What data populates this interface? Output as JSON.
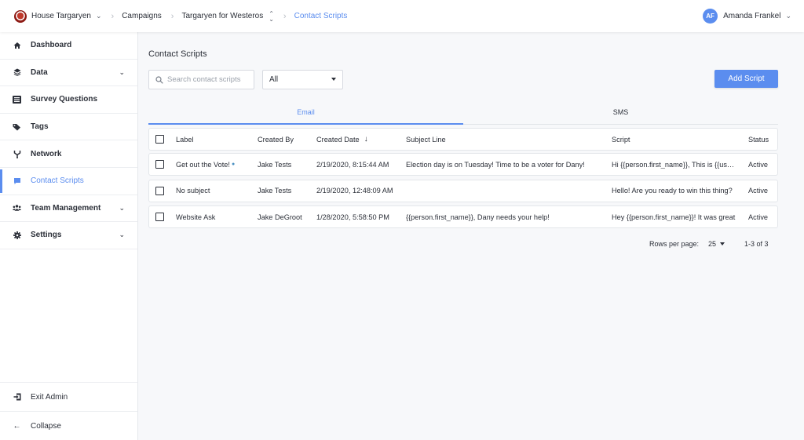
{
  "breadcrumbs": {
    "org": "House Targaryen",
    "campaigns": "Campaigns",
    "campaign": "Targaryen for Westeros",
    "current": "Contact Scripts"
  },
  "user": {
    "initials": "AF",
    "name": "Amanda Frankel"
  },
  "sidebar": {
    "items": [
      {
        "label": "Dashboard",
        "icon": "home-icon"
      },
      {
        "label": "Data",
        "icon": "layers-icon",
        "expandable": true
      },
      {
        "label": "Survey Questions",
        "icon": "list-icon"
      },
      {
        "label": "Tags",
        "icon": "tag-icon"
      },
      {
        "label": "Network",
        "icon": "network-icon"
      },
      {
        "label": "Contact Scripts",
        "icon": "chat-icon",
        "active": true
      },
      {
        "label": "Team Management",
        "icon": "team-icon",
        "expandable": true
      },
      {
        "label": "Settings",
        "icon": "gear-icon",
        "expandable": true
      }
    ],
    "bottom": {
      "exit": "Exit Admin",
      "collapse": "Collapse"
    }
  },
  "main": {
    "title": "Contact Scripts",
    "search_placeholder": "Search contact scripts",
    "filter_value": "All",
    "add_button": "Add Script",
    "tabs": [
      "Email",
      "SMS"
    ],
    "active_tab": "Email",
    "columns": {
      "label": "Label",
      "created_by": "Created By",
      "created_date": "Created Date",
      "subject": "Subject Line",
      "script": "Script",
      "status": "Status"
    },
    "rows": [
      {
        "label": "Get out the Vote!",
        "created_by": "Jake Tests",
        "created_date": "2/19/2020, 8:15:44 AM",
        "subject": "Election day is on Tuesday! Time to be a voter for Dany!",
        "script": "Hi {{person.first_name}}, This is {{user.first_name}}",
        "status": "Active"
      },
      {
        "label": "No subject",
        "created_by": "Jake Tests",
        "created_date": "2/19/2020, 12:48:09 AM",
        "subject": "",
        "script": "Hello! Are you ready to win this thing?",
        "status": "Active"
      },
      {
        "label": "Website Ask",
        "created_by": "Jake DeGroot",
        "created_date": "1/28/2020, 5:58:50 PM",
        "subject": "{{person.first_name}}, Dany needs your help!",
        "script": "Hey {{person.first_name}}! It was great",
        "status": "Active"
      }
    ],
    "pagination": {
      "rows_per_page_label": "Rows per page:",
      "rows_per_page": "25",
      "range": "1-3 of 3"
    }
  },
  "colors": {
    "accent": "#5b8def",
    "text": "#2b2f38"
  }
}
